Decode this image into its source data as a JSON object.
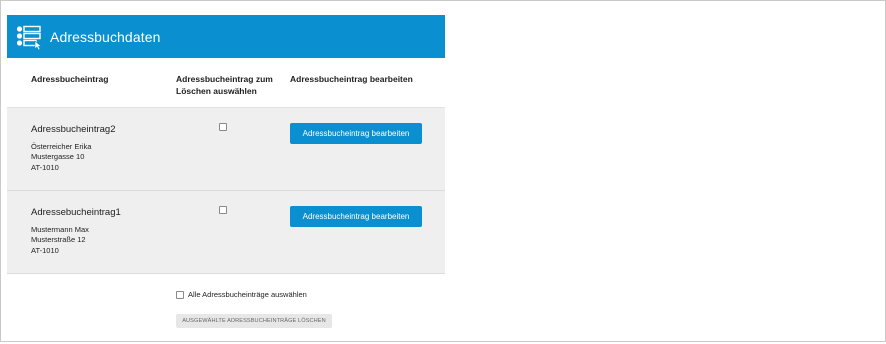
{
  "header": {
    "title": "Adressbuchdaten",
    "icon": "address-list-icon",
    "background": "#0a8fd0"
  },
  "columns": {
    "entry": "Adressbucheintrag",
    "select_line1": "Adressbucheintrag zum",
    "select_line2": "Löschen auswählen",
    "edit": "Adressbucheintrag bearbeiten"
  },
  "entries": [
    {
      "name": "Adressbucheintrag2",
      "address_line1": "Österreicher Erika",
      "address_line2": "Mustergasse 10",
      "address_line3": "AT-1010",
      "selected": false,
      "edit_label": "Adressbucheintrag bearbeiten"
    },
    {
      "name": "Adressebucheintrag1",
      "address_line1": "Mustermann Max",
      "address_line2": "Musterstraße 12",
      "address_line3": "AT-1010",
      "selected": false,
      "edit_label": "Adressbucheintrag bearbeiten"
    }
  ],
  "footer": {
    "select_all_label": "Alle Adressbucheinträge auswählen",
    "select_all_checked": false,
    "delete_label": "AUSGEWÄHLTE ADRESSBUCHEINTRÄGE LÖSCHEN"
  },
  "colors": {
    "accent": "#0a8fd0",
    "row_background": "#f0efef",
    "disabled_button": "#e7e7e7"
  }
}
